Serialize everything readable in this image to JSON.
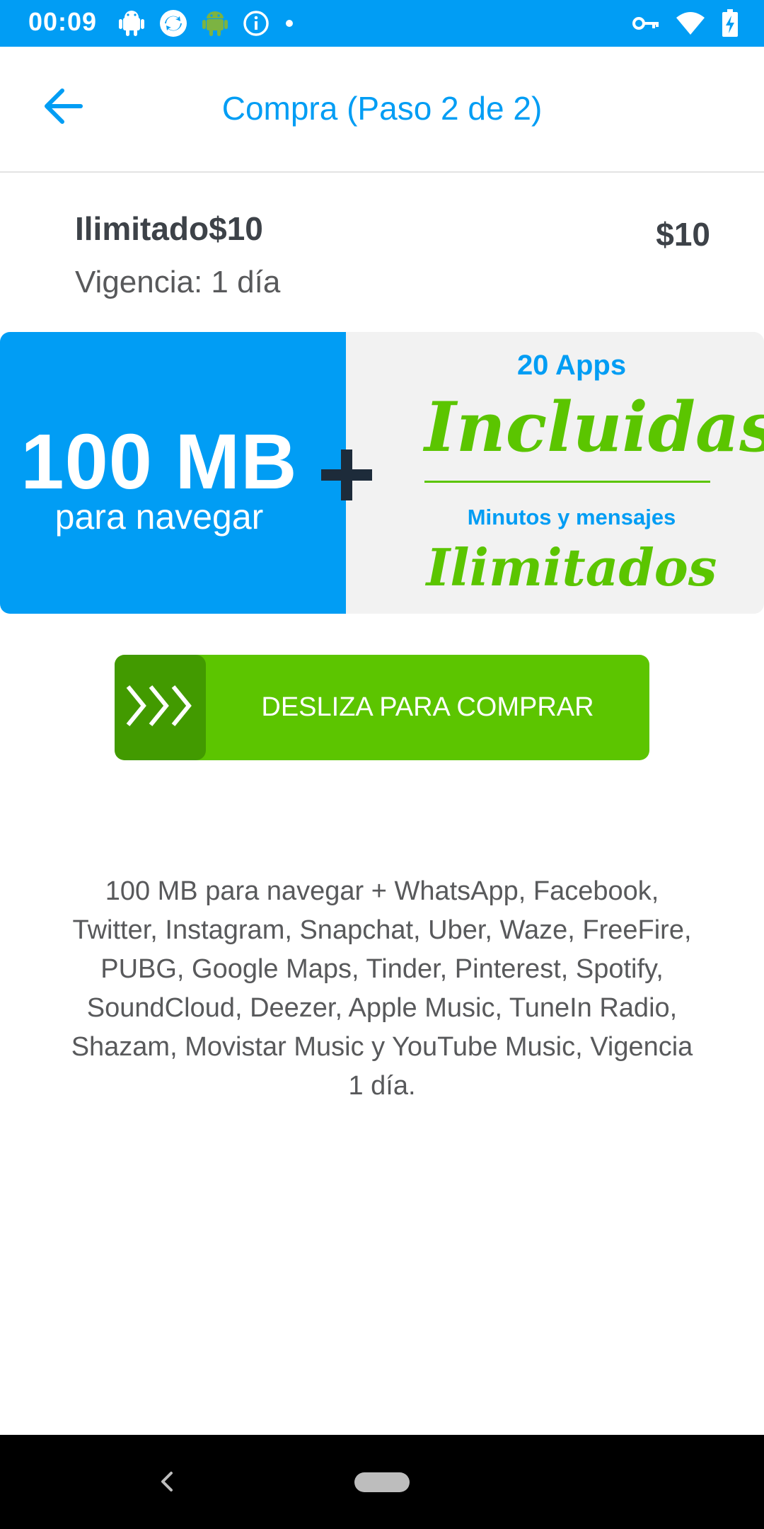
{
  "status_bar": {
    "time": "00:09",
    "background": "#019df4",
    "icons": [
      "android-icon",
      "sync-icon",
      "android-debug-icon",
      "info-icon",
      "dot-icon",
      "vpn-key-icon",
      "wifi-icon",
      "battery-charging-icon"
    ]
  },
  "header": {
    "title": "Compra (Paso 2 de 2)",
    "back_icon": "arrow-left-icon",
    "accent": "#019df4"
  },
  "plan": {
    "name": "Ilimitado$10",
    "validity": "Vigencia: 1 día",
    "price": "$10"
  },
  "banner": {
    "data_amount": "100 MB",
    "data_caption": "para navegar",
    "apps": "20 Apps",
    "apps_included": "Incluidas",
    "minutes": "Minutos y mensajes",
    "unlimited": "Ilimitados",
    "blue": "#019df4",
    "green": "#5bc500"
  },
  "slider": {
    "label": "DESLIZA PARA COMPRAR",
    "handle_icon": "chevrons-right-icon",
    "color": "#5cc500",
    "handle_color": "#429a00"
  },
  "description": "100 MB para navegar + WhatsApp, Facebook, Twitter, Instagram, Snapchat, Uber, Waze, FreeFire, PUBG, Google Maps, Tinder, Pinterest, Spotify, SoundCloud, Deezer, Apple Music, TuneIn Radio, Shazam, Movistar Music y YouTube Music, Vigencia 1 día.",
  "nav_bar": {
    "back_icon": "nav-back-icon",
    "home_icon": "home-pill-icon"
  }
}
